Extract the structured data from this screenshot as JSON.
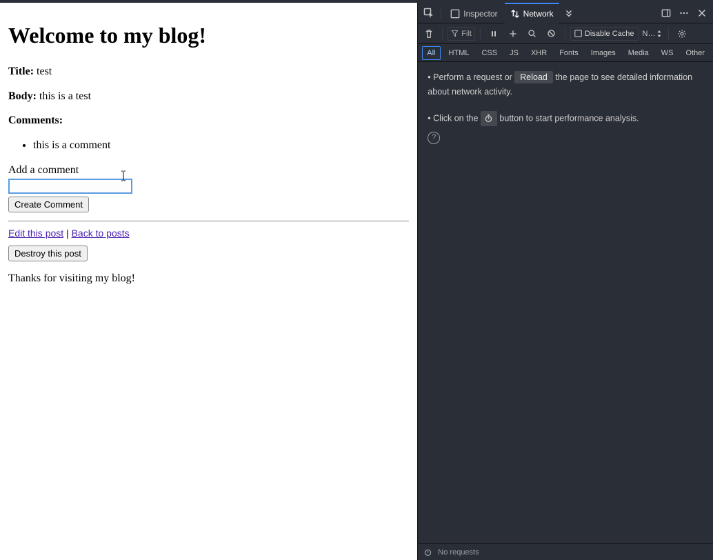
{
  "page": {
    "heading": "Welcome to my blog!",
    "title_label": "Title:",
    "title_value": "test",
    "body_label": "Body:",
    "body_value": "this is a test",
    "comments_label": "Comments:",
    "comments": [
      "this is a comment"
    ],
    "add_comment_label": "Add a comment",
    "create_comment_btn": "Create Comment",
    "edit_link": "Edit this post",
    "sep": " | ",
    "back_link": "Back to posts",
    "destroy_btn": "Destroy this post",
    "footer": "Thanks for visiting my blog!"
  },
  "devtools": {
    "tabs": {
      "inspector": "Inspector",
      "network": "Network"
    },
    "toolbar": {
      "filter_placeholder": "Filt",
      "disable_cache": "Disable Cache",
      "throttle": "N…"
    },
    "filters": {
      "all": "All",
      "html": "HTML",
      "css": "CSS",
      "js": "JS",
      "xhr": "XHR",
      "fonts": "Fonts",
      "images": "Images",
      "media": "Media",
      "ws": "WS",
      "other": "Other"
    },
    "body": {
      "line1_a": "• Perform a request or ",
      "reload": "Reload",
      "line1_b": " the page to see detailed information about network activity.",
      "line2_a": "• Click on the ",
      "line2_b": " button to start performance analysis."
    },
    "status": {
      "no_requests": "No requests"
    }
  }
}
